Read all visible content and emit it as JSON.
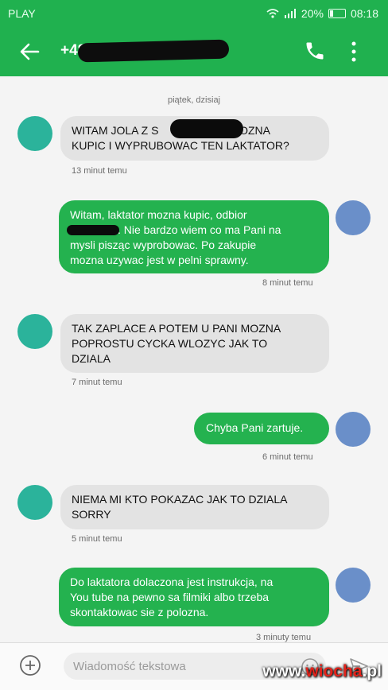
{
  "status_bar": {
    "carrier": "PLAY",
    "battery": "20%",
    "time": "08:18",
    "battery_level": 0.2
  },
  "header": {
    "contact": "+48",
    "back_icon": "arrow-left-icon",
    "phone_icon": "phone-icon",
    "more_icon": "more-vertical-icon"
  },
  "thread": {
    "date_separator": "piątek, dzisiaj",
    "messages": [
      {
        "dir": "in",
        "lines": [
          "WITAM JOLA Z S",
          "KUPIC I WYPRUBOWAC TEN LAKTATOR?"
        ],
        "line1_end": "C MOZNA",
        "time": "13 minut temu"
      },
      {
        "dir": "out",
        "lines": [
          "Witam, laktator mozna kupic, odbior",
          "mysli pisząc wyprobowac. Po zakupie",
          "mozna uzywac jest w pelni sprawny."
        ],
        "line2_tail": ". Nie bardzo wiem co ma Pani na",
        "time": "8 minut temu"
      },
      {
        "dir": "in",
        "lines": [
          "TAK ZAPLACE A POTEM U PANI MOZNA",
          "POPROSTU CYCKA WLOZYC JAK TO",
          "DZIALA"
        ],
        "time": "7 minut temu"
      },
      {
        "dir": "out",
        "lines": [
          "Chyba Pani zartuje."
        ],
        "time": "6 minut temu"
      },
      {
        "dir": "in",
        "lines": [
          "NIEMA MI KTO POKAZAC JAK TO DZIALA",
          "SORRY"
        ],
        "time": "5 minut temu"
      },
      {
        "dir": "out",
        "lines": [
          "Do laktatora dolaczona jest instrukcja, na",
          "You tube na pewno sa filmiki albo trzeba",
          "skontaktowac sie z polozna."
        ],
        "time": "3 minuty temu"
      }
    ]
  },
  "input": {
    "placeholder": "Wiadomość tekstowa",
    "add_icon": "add-circle-icon",
    "emoji_icon": "emoji-icon",
    "send_icon": "send-icon"
  },
  "watermark": {
    "prefix": "www.",
    "brand": "wiocha",
    "suffix": ".pl"
  },
  "colors": {
    "primary_green": "#20b14f",
    "outgoing_bubble": "#24b24f",
    "incoming_bubble": "#e3e3e3",
    "avatar_incoming": "#2bb39b",
    "avatar_outgoing": "#6a8fc9"
  }
}
